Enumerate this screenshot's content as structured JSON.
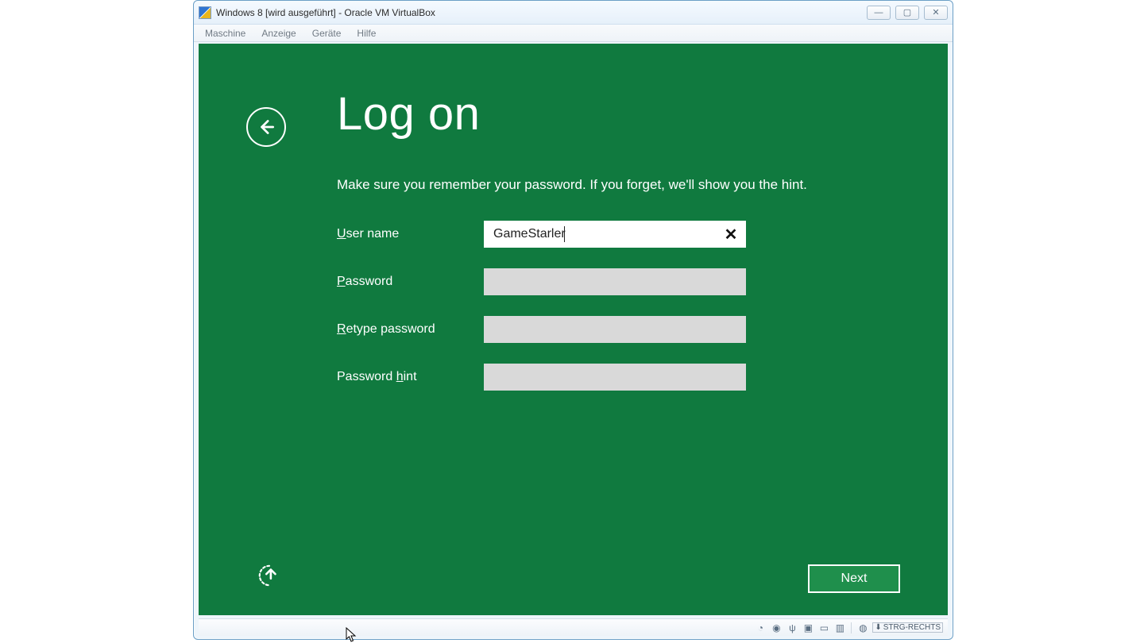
{
  "window": {
    "title": "Windows 8 [wird ausgeführt] - Oracle VM VirtualBox"
  },
  "menubar": {
    "items": [
      "Maschine",
      "Anzeige",
      "Geräte",
      "Hilfe"
    ]
  },
  "page": {
    "heading": "Log on",
    "subtitle": "Make sure you remember your password. If you forget, we'll show you the hint."
  },
  "form": {
    "username": {
      "label_head": "U",
      "label_rest": "ser name",
      "value": "GameStarler"
    },
    "password": {
      "label_head": "P",
      "label_rest": "assword",
      "value": ""
    },
    "retype": {
      "label_head": "R",
      "label_rest": "etype password",
      "value": ""
    },
    "hint": {
      "label_pre": "Password ",
      "label_head": "h",
      "label_rest": "int",
      "value": ""
    }
  },
  "buttons": {
    "next": "Next"
  },
  "statusbar": {
    "hostkey": "STRG-RECHTS"
  }
}
